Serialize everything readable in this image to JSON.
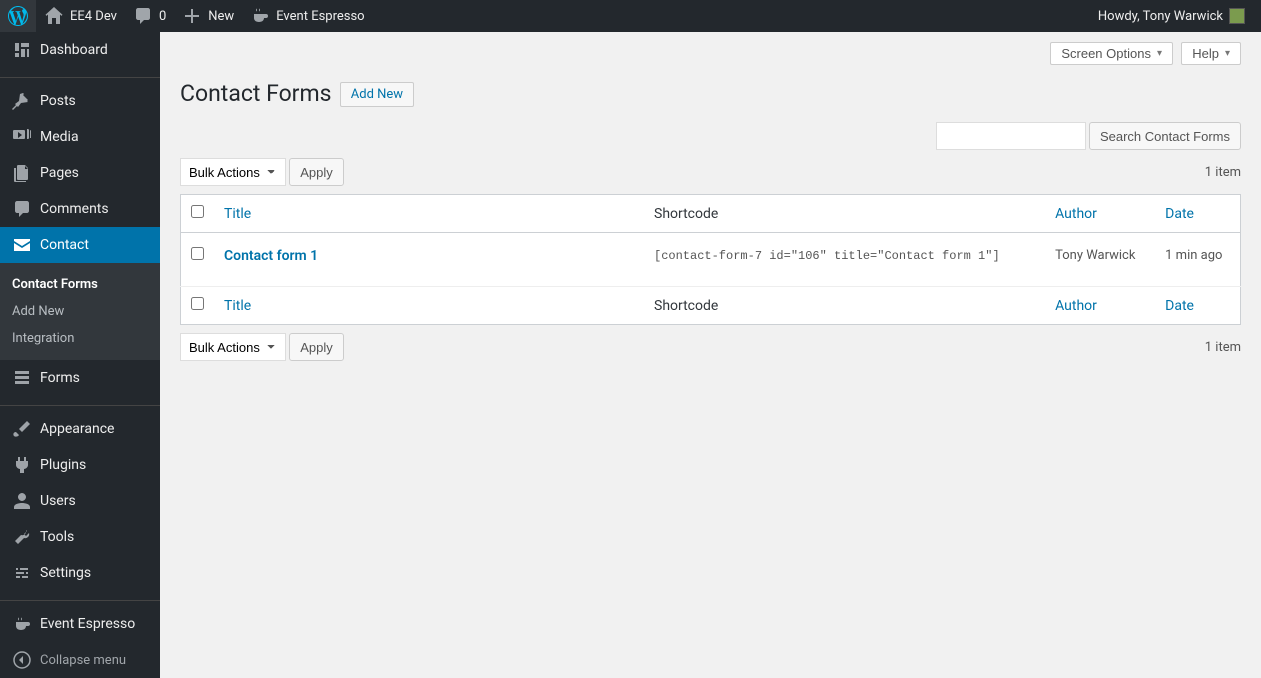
{
  "adminbar": {
    "site_name": "EE4 Dev",
    "comments": "0",
    "new": "New",
    "event_espresso": "Event Espresso",
    "howdy": "Howdy, Tony Warwick"
  },
  "sidebar": {
    "dashboard": "Dashboard",
    "posts": "Posts",
    "media": "Media",
    "pages": "Pages",
    "comments": "Comments",
    "contact": "Contact",
    "forms": "Forms",
    "appearance": "Appearance",
    "plugins": "Plugins",
    "users": "Users",
    "tools": "Tools",
    "settings": "Settings",
    "eventespresso": "Event Espresso",
    "collapse": "Collapse menu",
    "submenu": {
      "contact_forms": "Contact Forms",
      "add_new": "Add New",
      "integration": "Integration"
    }
  },
  "screen": {
    "screen_options": "Screen Options",
    "help": "Help"
  },
  "page": {
    "title": "Contact Forms",
    "add_new": "Add New",
    "search_button": "Search Contact Forms",
    "bulk_actions": "Bulk Actions",
    "apply": "Apply",
    "items_count": "1 item"
  },
  "columns": {
    "title": "Title",
    "shortcode": "Shortcode",
    "author": "Author",
    "date": "Date"
  },
  "rows": [
    {
      "title": "Contact form 1",
      "shortcode": "[contact-form-7 id=\"106\" title=\"Contact form 1\"]",
      "author": "Tony Warwick",
      "date": "1 min ago"
    }
  ]
}
